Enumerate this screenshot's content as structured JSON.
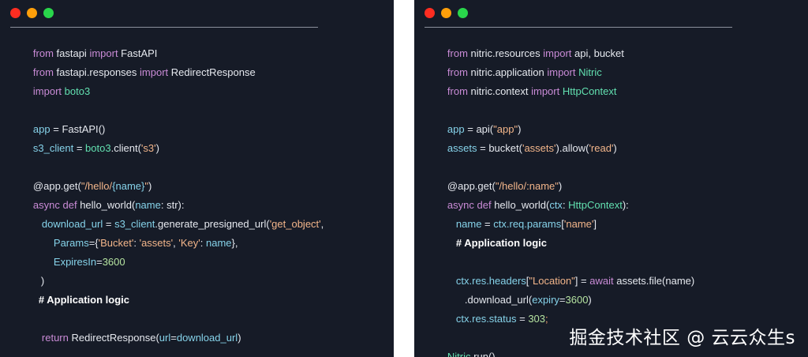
{
  "colors": {
    "panel_bg": "#161b27",
    "keyword": "#c98bd6",
    "function": "#86d3ea",
    "string": "#f2b58a",
    "class": "#62e0b0",
    "number": "#b5e3a0",
    "window_dot_red": "#ff2d21",
    "window_dot_yellow": "#ff9f0a",
    "window_dot_green": "#29d64b"
  },
  "left": {
    "l1": [
      "from",
      " fastapi ",
      "import",
      " FastAPI"
    ],
    "l2": [
      "from",
      " fastapi.responses ",
      "import",
      " RedirectResponse"
    ],
    "l3": [
      "import",
      " boto3"
    ],
    "l4": [
      "app",
      " = ",
      "FastAPI",
      "()"
    ],
    "l5": [
      "s3_client",
      " = ",
      "boto3",
      ".",
      "client",
      "(",
      "'s3'",
      ")"
    ],
    "l6": [
      "@app.get",
      "(",
      "\"/hello/",
      "{name}",
      "\"",
      ")"
    ],
    "l7": [
      "async",
      " ",
      "def",
      " ",
      "hello_world",
      "(",
      "name",
      ": ",
      "str",
      "):"
    ],
    "l8": [
      "download_url",
      " = ",
      "s3_client",
      ".",
      "generate_presigned_url",
      "(",
      "'get_object'",
      ","
    ],
    "l9": [
      "Params",
      "={",
      "'Bucket'",
      ": ",
      "'assets'",
      ", ",
      "'Key'",
      ": ",
      "name",
      "},"
    ],
    "l10": [
      "ExpiresIn",
      "=",
      "3600"
    ],
    "l11": ")",
    "l12": "# Application logic",
    "l13": [
      "return",
      " ",
      "RedirectResponse",
      "(",
      "url",
      "=",
      "download_url",
      ")"
    ]
  },
  "right": {
    "l1": [
      "from",
      " nitric.resources ",
      "import",
      " api, bucket"
    ],
    "l2": [
      "from",
      " nitric.application ",
      "import",
      " Nitric"
    ],
    "l3": [
      "from",
      " nitric.context ",
      "import",
      " HttpContext"
    ],
    "l4": [
      "app",
      " = ",
      "api",
      "(",
      "\"app\"",
      ")"
    ],
    "l5": [
      "assets",
      " = ",
      "bucket",
      "(",
      "'assets'",
      ").",
      "allow",
      "(",
      "'read'",
      ")"
    ],
    "l6": [
      "@app.get",
      "(",
      "\"/hello/:name\"",
      ")"
    ],
    "l7": [
      "async",
      " ",
      "def",
      " ",
      "hello_world",
      "(",
      "ctx",
      ": ",
      "HttpContext",
      "):"
    ],
    "l8": [
      "name",
      " = ",
      "ctx.req.params",
      "[",
      "'name'",
      "]"
    ],
    "l9": "# Application logic",
    "l10": [
      "ctx.res.headers",
      "[",
      "\"Location\"",
      "] = ",
      "await",
      " ",
      "assets",
      ".",
      "file",
      "(",
      "name",
      ")"
    ],
    "l11": [
      ".",
      "download_url",
      "(",
      "expiry",
      "=",
      "3600",
      ")"
    ],
    "l12": [
      "ctx.res.status",
      " = ",
      "303",
      ";"
    ],
    "l13": [
      "Nitric",
      ".",
      "run",
      "()"
    ]
  },
  "watermark": "掘金技术社区 @ 云云众生s"
}
